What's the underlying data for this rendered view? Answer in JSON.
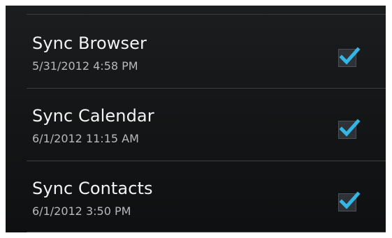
{
  "sync_items": [
    {
      "label": "Sync Browser",
      "last_sync": "5/31/2012 4:58 PM",
      "checked": true,
      "check_icon": "checkmark-icon"
    },
    {
      "label": "Sync Calendar",
      "last_sync": "6/1/2012 11:15 AM",
      "checked": true,
      "check_icon": "checkmark-icon"
    },
    {
      "label": "Sync Contacts",
      "last_sync": "6/1/2012 3:50 PM",
      "checked": true,
      "check_icon": "checkmark-icon"
    }
  ],
  "colors": {
    "background": "#141617",
    "title_text": "#f3f3f3",
    "subtitle_text": "#b7b9bb",
    "divider": "#3b3e41",
    "check_accent": "#33b5e5"
  }
}
